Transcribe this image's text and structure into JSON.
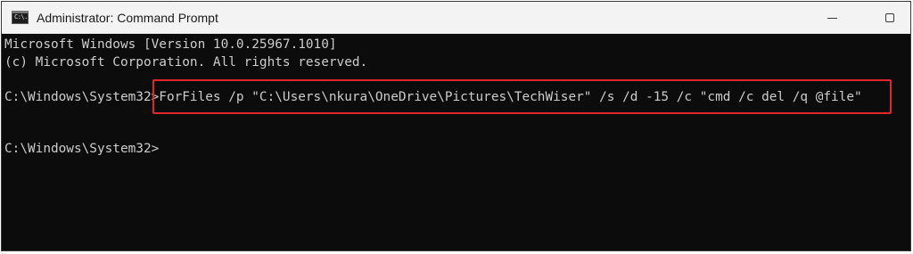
{
  "window": {
    "title": "Administrator: Command Prompt",
    "app_icon_label": "C:\\.",
    "icons": {
      "app": "command-prompt-icon",
      "minimize": "minimize-icon",
      "maximize": "maximize-icon"
    }
  },
  "console": {
    "lines": [
      {
        "text": "Microsoft Windows [Version 10.0.25967.1010]"
      },
      {
        "text": "(c) Microsoft Corporation. All rights reserved."
      },
      {
        "prompt": "C:\\Windows\\System32>",
        "command": "ForFiles /p \"C:\\Users\\nkura\\OneDrive\\Pictures\\TechWiser\" /s /d -15 /c \"cmd /c del /q @file\""
      },
      {
        "prompt": "C:\\Windows\\System32>",
        "command": ""
      }
    ]
  },
  "colors": {
    "console_background": "#0c0c0c",
    "console_text": "#cccccc",
    "titlebar_background": "#f3f3f3",
    "highlight_border": "#e0262b"
  }
}
